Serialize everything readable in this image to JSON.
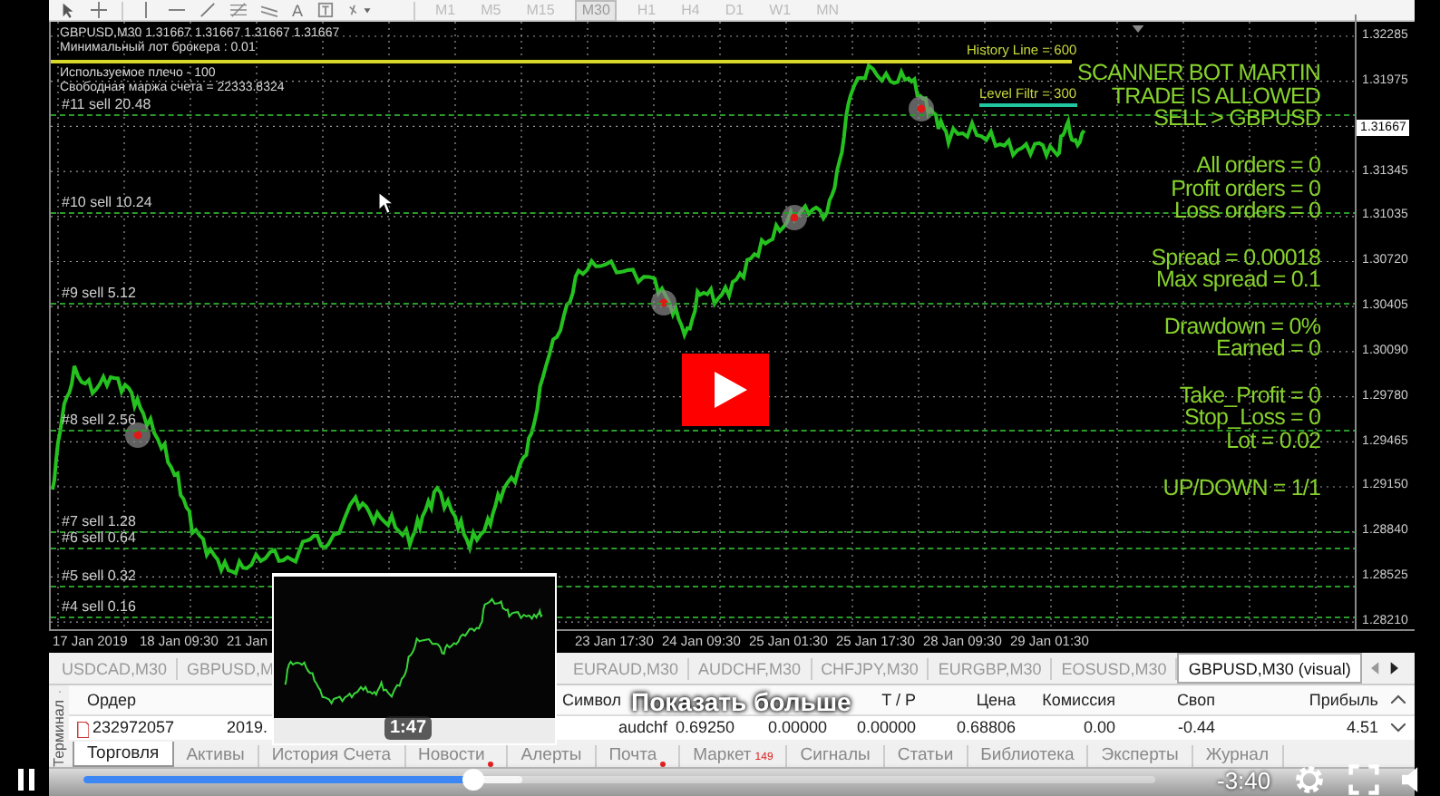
{
  "toolbar": {
    "text_tool_glyph": "A",
    "timeframes": [
      {
        "label": "M1",
        "selected": false
      },
      {
        "label": "M5",
        "selected": false
      },
      {
        "label": "M15",
        "selected": false
      },
      {
        "label": "M30",
        "selected": true
      },
      {
        "label": "H1",
        "selected": false
      },
      {
        "label": "H4",
        "selected": false
      },
      {
        "label": "D1",
        "selected": false
      },
      {
        "label": "W1",
        "selected": false
      },
      {
        "label": "MN",
        "selected": false
      }
    ]
  },
  "chart": {
    "header_lines": [
      "GBPUSD,M30 1.31667 1.31667 1.31667 1.31667",
      "Минимальный лот брокера : 0.01",
      "Используемое плечо - 100",
      "Свободная маржа счета = 22333.8324"
    ],
    "orders": [
      "#11 sell 20.48",
      "#10 sell 10.24",
      "#9 sell 5.12",
      "#8 sell 2.56",
      "#7 sell 1.28",
      "#6 sell 0.64",
      "#5 sell 0.32",
      "#4 sell 0.16"
    ],
    "history_line_label": "History Line = 600",
    "level_filter_label": "Level Filtr = 300",
    "info_groups": [
      [
        "SCANNER BOT MARTIN",
        "TRADE IS ALLOWED",
        "SELL > GBPUSD"
      ],
      [
        "All orders = 0",
        "Profit orders = 0",
        "Loss orders = 0"
      ],
      [
        "Spread = 0.00018",
        "Max spread = 0.1"
      ],
      [
        "Drawdown = 0%",
        "Earned = 0"
      ],
      [
        "Take_Profit = 0",
        "Stop_Loss = 0",
        "Lot = 0.02"
      ],
      [
        "UP/DOWN = 1/1"
      ]
    ],
    "price_axis": [
      {
        "text": "1.32285",
        "current": false
      },
      {
        "text": "1.31975",
        "current": false
      },
      {
        "text": "1.31667",
        "current": true
      },
      {
        "text": "1.31345",
        "current": false
      },
      {
        "text": "1.31035",
        "current": false
      },
      {
        "text": "1.30720",
        "current": false
      },
      {
        "text": "1.30405",
        "current": false
      },
      {
        "text": "1.30090",
        "current": false
      },
      {
        "text": "1.29780",
        "current": false
      },
      {
        "text": "1.29465",
        "current": false
      },
      {
        "text": "1.29150",
        "current": false
      },
      {
        "text": "1.28840",
        "current": false
      },
      {
        "text": "1.28525",
        "current": false
      },
      {
        "text": "1.28210",
        "current": false
      }
    ],
    "time_axis": [
      "17 Jan 2019",
      "18 Jan 09:30",
      "21 Jan",
      "23 Jan 17:30",
      "24 Jan 09:30",
      "25 Jan 01:30",
      "25 Jan 17:30",
      "28 Jan 09:30",
      "29 Jan 01:30"
    ]
  },
  "symbol_tabs": [
    {
      "label": "USDCAD,M30",
      "selected": false
    },
    {
      "label": "GBPUSD,M",
      "selected": false
    },
    {
      "label": "EURAUD,M30",
      "selected": false
    },
    {
      "label": "AUDCHF,M30",
      "selected": false
    },
    {
      "label": "CHFJPY,M30",
      "selected": false
    },
    {
      "label": "EURGBP,M30",
      "selected": false
    },
    {
      "label": "EOSUSD,M30",
      "selected": false
    },
    {
      "label": "GBPUSD,M30 (visual)",
      "selected": true
    }
  ],
  "terminal": {
    "side_label": "Терминал",
    "columns": [
      "Ордер",
      null,
      "Символ",
      null,
      null,
      "T / P",
      "Цена",
      "Комиссия",
      "Своп",
      "Прибыль"
    ],
    "rows": [
      {
        "cells": [
          "232972057",
          "2019.",
          "audchf",
          "0.69250",
          "0.00000",
          "0.00000",
          "0.68806",
          "0.00",
          "-0.44",
          "4.51"
        ]
      }
    ],
    "tabs": [
      {
        "label": "Торговля",
        "selected": true,
        "alert": false
      },
      {
        "label": "Активы",
        "selected": false,
        "alert": false
      },
      {
        "label": "История Счета",
        "selected": false,
        "alert": false
      },
      {
        "label": "Новости",
        "selected": false,
        "alert": true
      },
      {
        "label": "Алерты",
        "selected": false,
        "alert": false
      },
      {
        "label": "Почта",
        "selected": false,
        "alert": true
      },
      {
        "label": "Маркет",
        "selected": false,
        "alert": false,
        "badge": "149"
      },
      {
        "label": "Сигналы",
        "selected": false,
        "alert": false
      },
      {
        "label": "Статьи",
        "selected": false,
        "alert": false
      },
      {
        "label": "Библиотека",
        "selected": false,
        "alert": false
      },
      {
        "label": "Эксперты",
        "selected": false,
        "alert": false
      },
      {
        "label": "Журнал",
        "selected": false,
        "alert": false
      }
    ]
  },
  "player": {
    "show_more": "Показать больше",
    "preview_time": "1:47",
    "remaining": "-3:40",
    "level": 0.364
  }
}
